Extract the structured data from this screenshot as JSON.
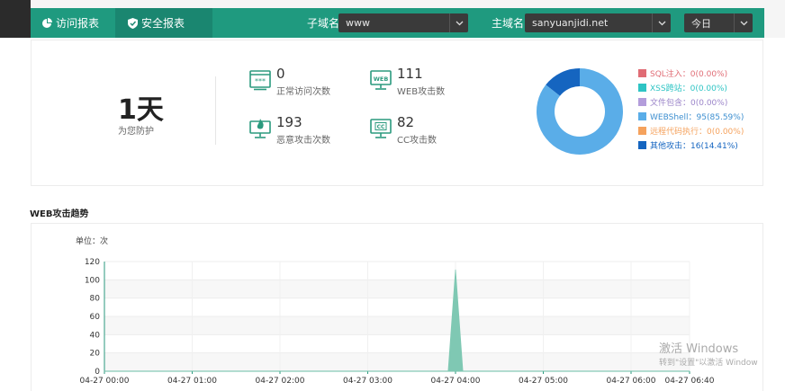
{
  "nav": {
    "tabs": [
      {
        "label": "访问报表",
        "icon": "pie-chart-icon"
      },
      {
        "label": "安全报表",
        "icon": "shield-icon"
      }
    ],
    "subdomain_label": "子域名",
    "subdomain_value": "www",
    "domain_label": "主域名",
    "domain_value": "sanyuanjidi.net",
    "range_value": "今日"
  },
  "summary": {
    "days": "1天",
    "days_label": "为您防护",
    "stats": [
      {
        "value": "0",
        "label": "正常访问次数",
        "icon": "browser-stars-icon"
      },
      {
        "value": "111",
        "label": "WEB攻击数",
        "icon": "web-monitor-icon"
      },
      {
        "value": "193",
        "label": "恶意攻击次数",
        "icon": "fire-monitor-icon"
      },
      {
        "value": "82",
        "label": "CC攻击数",
        "icon": "cc-monitor-icon"
      }
    ]
  },
  "donut": {
    "legend": [
      {
        "label": "SQL注入：0(0.00%)",
        "color": "#e06c75",
        "value": 0
      },
      {
        "label": "XSS跨站：0(0.00%)",
        "color": "#2ec4c4",
        "value": 0
      },
      {
        "label": "文件包含：0(0.00%)",
        "color": "#b39ddb",
        "value": 0
      },
      {
        "label": "WEBShell：95(85.59%)",
        "color": "#5aade8",
        "value": 95
      },
      {
        "label": "远程代码执行：0(0.00%)",
        "color": "#f5a25d",
        "value": 0
      },
      {
        "label": "其他攻击：16(14.41%)",
        "color": "#1565c0",
        "value": 16
      }
    ]
  },
  "trend": {
    "title": "WEB攻击趋势",
    "unit": "单位：次"
  },
  "chart_data": {
    "type": "area",
    "title": "",
    "xlabel": "",
    "ylabel": "",
    "x": [
      "04-27 00:00",
      "04-27 01:00",
      "04-27 02:00",
      "04-27 03:00",
      "04-27 04:00",
      "04-27 05:00",
      "04-27 06:00",
      "04-27 06:40"
    ],
    "yticks": [
      0,
      20,
      40,
      60,
      80,
      100,
      120
    ],
    "ylim": [
      0,
      120
    ],
    "series": [
      {
        "color": "#7fc8b3",
        "points": [
          [
            "04-27 00:00",
            0
          ],
          [
            "04-27 03:55",
            0
          ],
          [
            "04-27 04:00",
            111
          ],
          [
            "04-27 04:05",
            0
          ],
          [
            "04-27 06:40",
            0
          ]
        ]
      }
    ],
    "grid": true
  },
  "watermark": {
    "line1": "激活 Windows",
    "line2": "转到\"设置\"以激活 Window"
  },
  "colors": {
    "nav": "#1f9a7f",
    "nav_active": "#1a8670",
    "icon": "#2b9a7e",
    "area": "#7fc8b3"
  }
}
